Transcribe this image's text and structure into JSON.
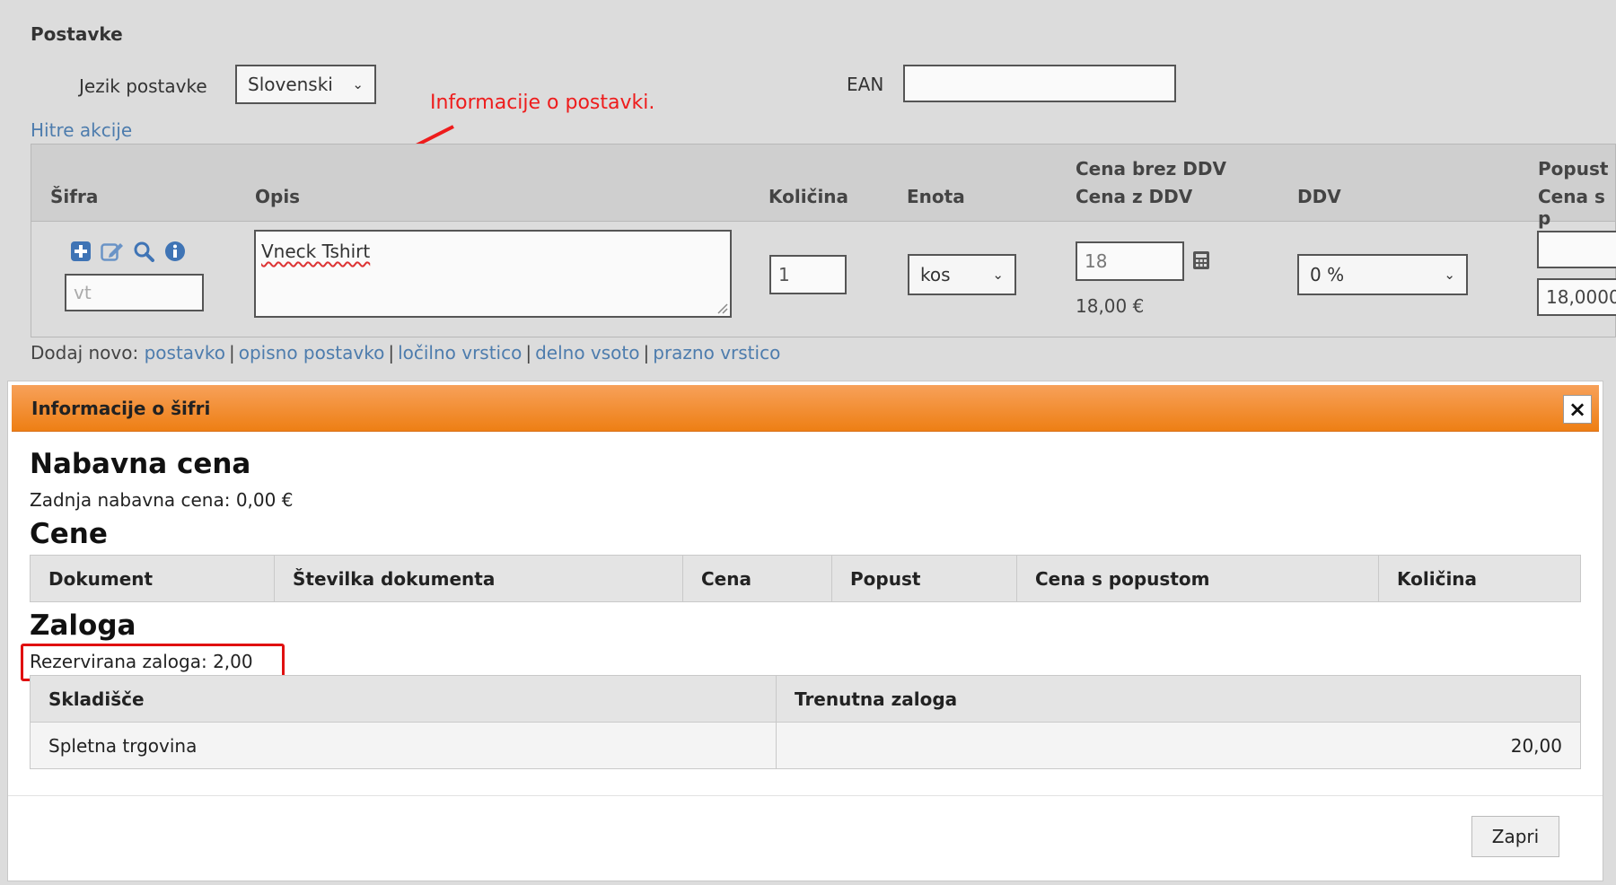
{
  "section": {
    "title": "Postavke"
  },
  "form": {
    "language_label": "Jezik postavke",
    "language_value": "Slovenski",
    "ean_label": "EAN",
    "ean_value": "",
    "quick_actions": "Hitre akcije"
  },
  "annotation": {
    "text": "Informacije o postavki."
  },
  "items_table": {
    "headers": {
      "sifra": "Šifra",
      "opis": "Opis",
      "kolicina": "Količina",
      "enota": "Enota",
      "cena_brez": "Cena brez DDV",
      "cena_z": "Cena z DDV",
      "ddv": "DDV",
      "popust": "Popust",
      "cena_s": "Cena s p"
    },
    "row": {
      "sifra_value": "vt",
      "opis_value": "Vneck Tshirt",
      "kolicina_value": "1",
      "enota_value": "kos",
      "cena_input": "18",
      "cena_z_ddv": "18,00 €",
      "ddv_value": "0 %",
      "popust_value": "",
      "cena_s_value": "18,0000"
    }
  },
  "add_new": {
    "label": "Dodaj novo:",
    "links": [
      "postavko",
      "opisno postavko",
      "ločilno vrstico",
      "delno vsoto",
      "prazno vrstico"
    ]
  },
  "modal": {
    "title": "Informacije o šifri",
    "close_symbol": "×",
    "nabavna": {
      "heading": "Nabavna cena",
      "text": "Zadnja nabavna cena: 0,00 €"
    },
    "cene": {
      "heading": "Cene",
      "columns": [
        "Dokument",
        "Številka dokumenta",
        "Cena",
        "Popust",
        "Cena s popustom",
        "Količina"
      ]
    },
    "zaloga": {
      "heading": "Zaloga",
      "reserved": "Rezervirana zaloga: 2,00",
      "columns": [
        "Skladišče",
        "Trenutna zaloga"
      ],
      "rows": [
        {
          "warehouse": "Spletna trgovina",
          "stock": "20,00"
        }
      ]
    },
    "close_button": "Zapri"
  },
  "colors": {
    "annotation": "#ee1c1c",
    "modal_header": "#ee7f14",
    "link": "#4d7cad",
    "icon": "#3f74b5"
  },
  "icons": [
    "plus-icon",
    "edit-icon",
    "search-icon",
    "info-icon",
    "calculator-icon",
    "chevron-down-icon",
    "close-icon",
    "resize-handle-icon"
  ]
}
